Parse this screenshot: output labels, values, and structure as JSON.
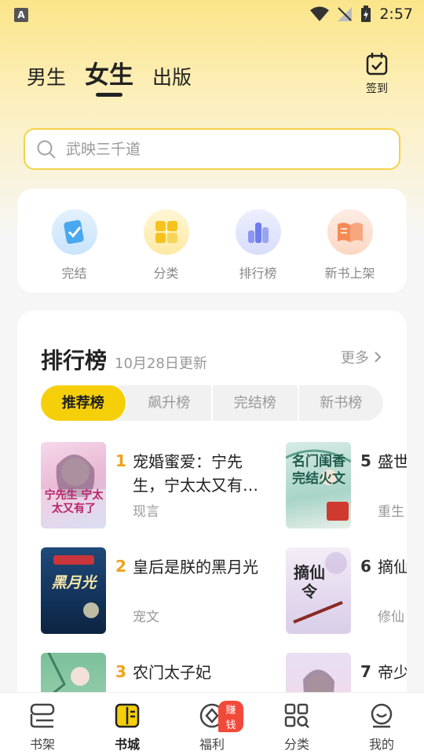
{
  "status_bar": {
    "time": "2:57"
  },
  "header": {
    "tabs": [
      {
        "label": "男生",
        "active": false
      },
      {
        "label": "女生",
        "active": true
      },
      {
        "label": "出版",
        "active": false
      }
    ],
    "checkin_label": "签到"
  },
  "search": {
    "placeholder": "武映三千道"
  },
  "quick_entries": [
    {
      "label": "完结",
      "icon": "check-book-icon"
    },
    {
      "label": "分类",
      "icon": "grid-tiles-icon"
    },
    {
      "label": "排行榜",
      "icon": "bar-chart-icon"
    },
    {
      "label": "新书上架",
      "icon": "open-book-icon"
    }
  ],
  "ranking": {
    "title": "排行榜",
    "updated": "10月28日更新",
    "more_label": "更多",
    "tabs": [
      {
        "label": "推荐榜",
        "active": true
      },
      {
        "label": "飙升榜",
        "active": false
      },
      {
        "label": "完结榜",
        "active": false
      },
      {
        "label": "新书榜",
        "active": false
      }
    ],
    "books": [
      {
        "rank": "1",
        "title": "宠婚蜜爱：宁先生，宁太太又有…",
        "genre": "现言",
        "cover_text": "宁先生 宁太太又有了"
      },
      {
        "rank": "2",
        "title": "皇后是朕的黑月光",
        "genre": "宠文",
        "cover_text": "黑月光"
      },
      {
        "rank": "3",
        "title": "农门太子妃",
        "genre": "",
        "cover_text": ""
      },
      {
        "rank": "5",
        "title": "盛世闺香",
        "genre": "重生",
        "cover_text": "名门闺香 完结火文"
      },
      {
        "rank": "6",
        "title": "摘仙",
        "genre": "修仙",
        "cover_text": "摘仙令"
      },
      {
        "rank": "7",
        "title": "帝少",
        "genre": "",
        "cover_text": ""
      }
    ]
  },
  "bottom_nav": [
    {
      "label": "书架",
      "active": false
    },
    {
      "label": "书城",
      "active": true
    },
    {
      "label": "福利",
      "active": false,
      "badge": "赚钱"
    },
    {
      "label": "分类",
      "active": false
    },
    {
      "label": "我的",
      "active": false
    }
  ],
  "colors": {
    "accent": "#f5cf0a",
    "rank_top": "#f0a21a",
    "badge": "#f24a3a"
  }
}
